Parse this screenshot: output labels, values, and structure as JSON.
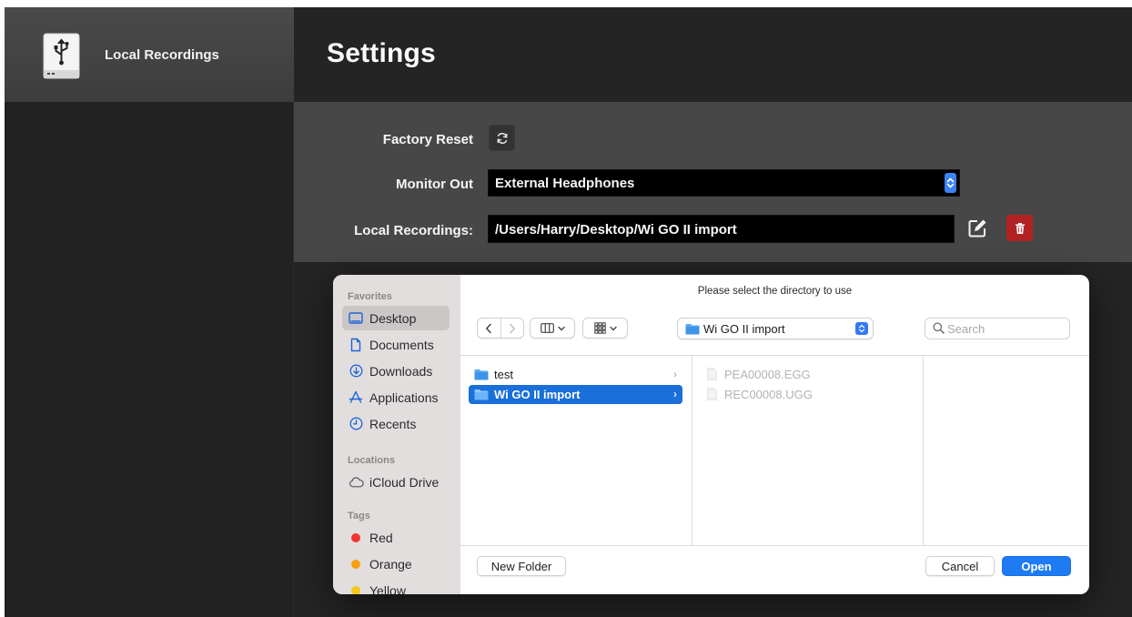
{
  "sidebar": {
    "item_label": "Local Recordings",
    "icon": "usb-drive-icon"
  },
  "header": {
    "title": "Settings"
  },
  "settings": {
    "factory_reset_label": "Factory Reset",
    "monitor_out_label": "Monitor Out",
    "monitor_out_value": "External Headphones",
    "local_recordings_label": "Local Recordings:",
    "local_recordings_path": "/Users/Harry/Desktop/Wi GO II import"
  },
  "dialog": {
    "title": "Please select the directory to use",
    "favorites_heading": "Favorites",
    "favorites": [
      {
        "label": "Desktop",
        "icon": "desktop-icon",
        "selected": true
      },
      {
        "label": "Documents",
        "icon": "document-icon"
      },
      {
        "label": "Downloads",
        "icon": "download-icon"
      },
      {
        "label": "Applications",
        "icon": "applications-icon"
      },
      {
        "label": "Recents",
        "icon": "clock-icon"
      }
    ],
    "locations_heading": "Locations",
    "locations": [
      {
        "label": "iCloud Drive",
        "icon": "cloud-icon"
      }
    ],
    "tags_heading": "Tags",
    "tags": [
      {
        "label": "Red",
        "color": "#f2362f"
      },
      {
        "label": "Orange",
        "color": "#f5a011"
      },
      {
        "label": "Yellow",
        "color": "#f6c61a"
      }
    ],
    "location_popup": "Wi GO II import",
    "search_placeholder": "Search",
    "columns": {
      "folders": [
        {
          "name": "test",
          "selected": false
        },
        {
          "name": "Wi GO II import",
          "selected": true
        }
      ],
      "files": [
        "PEA00008.EGG",
        "REC00008.UGG"
      ]
    },
    "new_folder_label": "New Folder",
    "cancel_label": "Cancel",
    "open_label": "Open"
  }
}
